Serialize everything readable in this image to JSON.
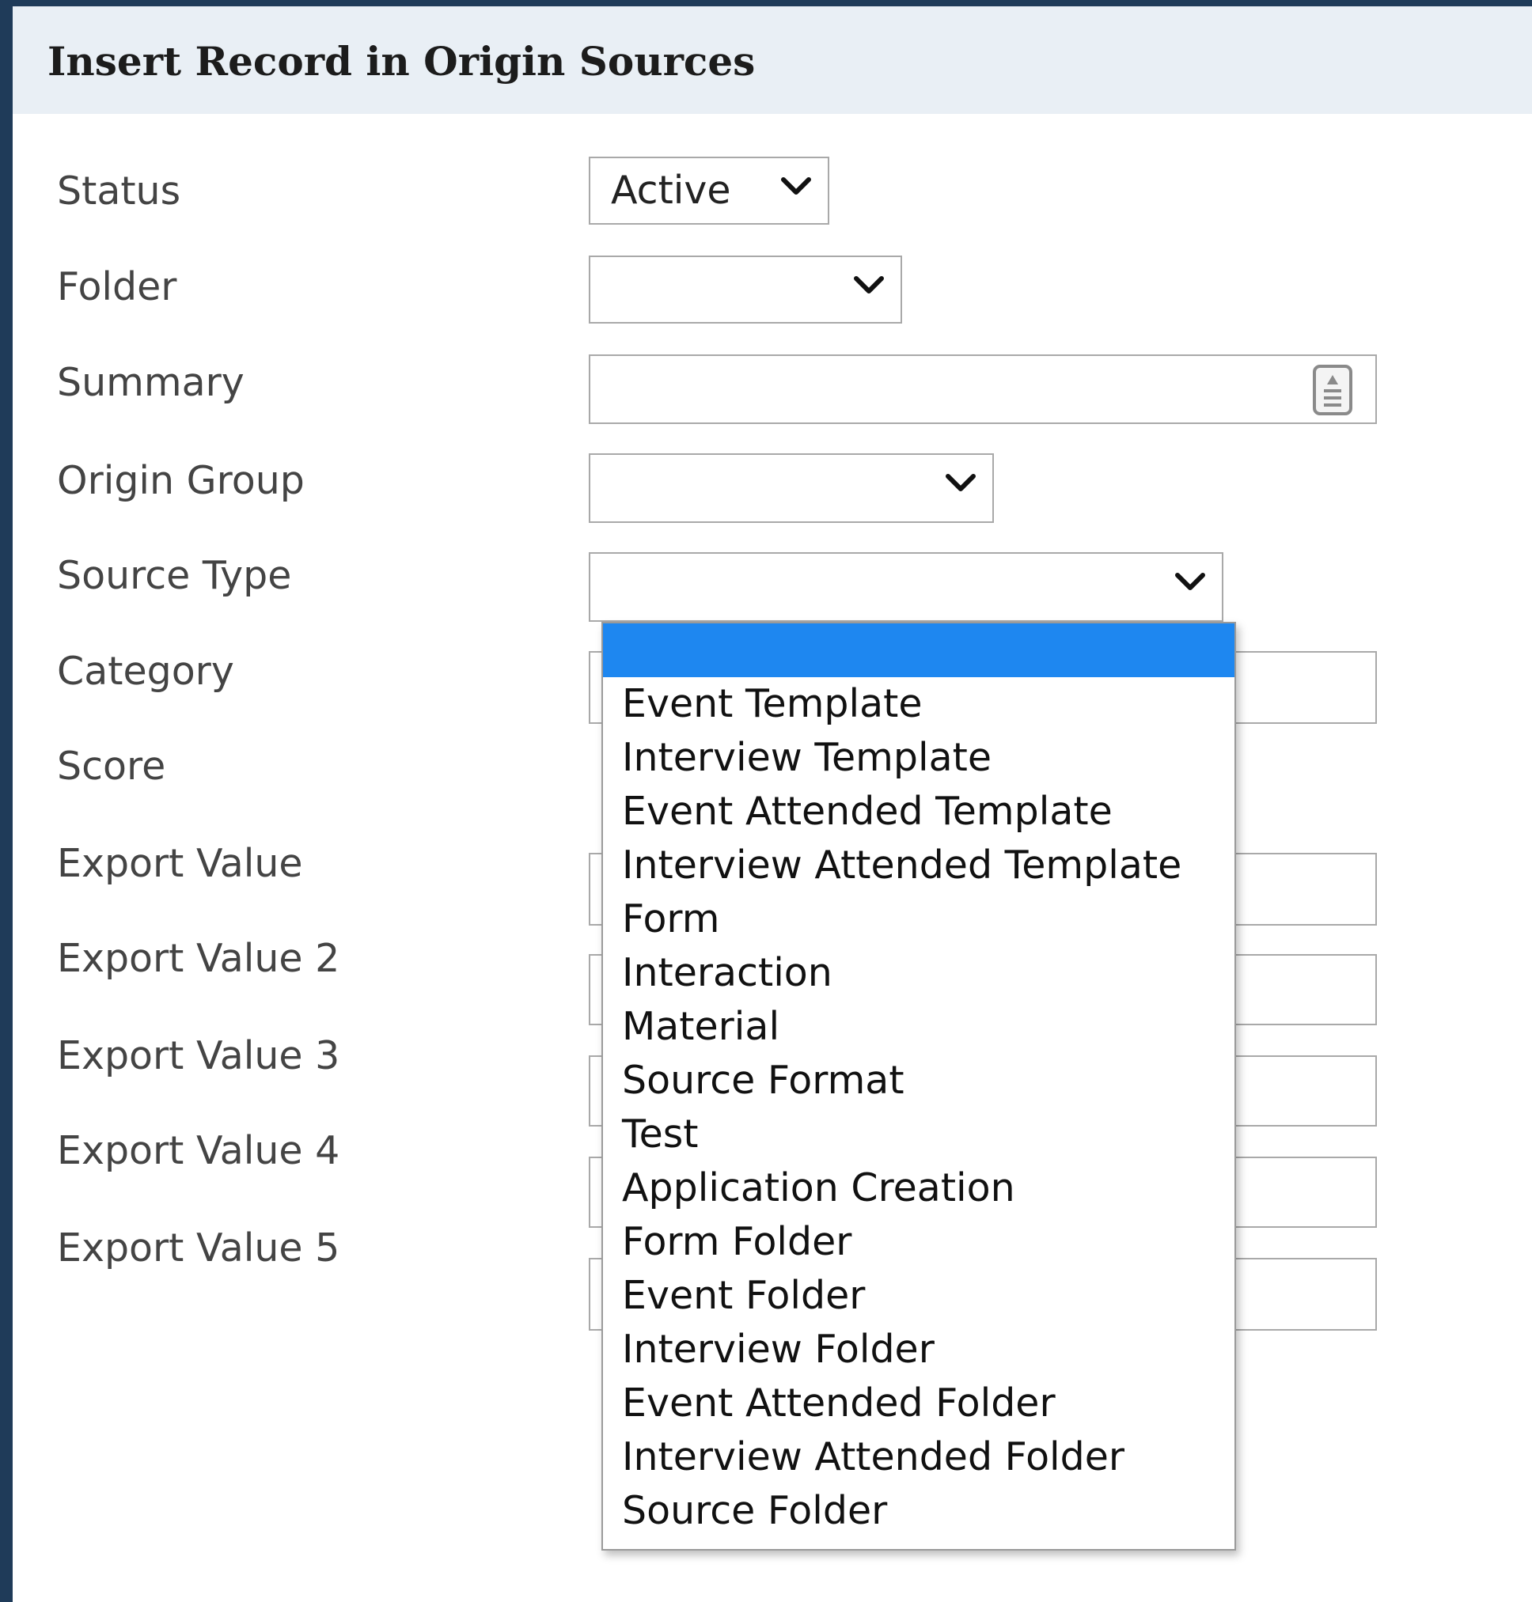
{
  "dialog": {
    "title": "Insert Record in Origin Sources"
  },
  "fields": {
    "status_label": "Status",
    "status_value": "Active",
    "folder_label": "Folder",
    "folder_value": "",
    "summary_label": "Summary",
    "summary_value": "",
    "origin_group_label": "Origin Group",
    "origin_group_value": "",
    "source_type_label": "Source Type",
    "source_type_value": "",
    "category_label": "Category",
    "score_label": "Score",
    "export_value_label": "Export Value",
    "export_value_2_label": "Export Value 2",
    "export_value_3_label": "Export Value 3",
    "export_value_4_label": "Export Value 4",
    "export_value_5_label": "Export Value 5"
  },
  "source_type_dropdown": {
    "selected_index": 0,
    "options": [
      "",
      "Event Template",
      "Interview Template",
      "Event Attended Template",
      "Interview Attended Template",
      "Form",
      "Interaction",
      "Material",
      "Source Format",
      "Test",
      "Application Creation",
      "Form Folder",
      "Event Folder",
      "Interview Folder",
      "Event Attended Folder",
      "Interview Attended Folder",
      "Source Folder"
    ]
  },
  "icons": {
    "select_arrow": "chevron-down-icon",
    "summary_picker": "text-picker-icon"
  },
  "colors": {
    "page_frame": "#1f3b59",
    "header_bg": "#e9eff5",
    "highlight": "#1e87f0"
  }
}
